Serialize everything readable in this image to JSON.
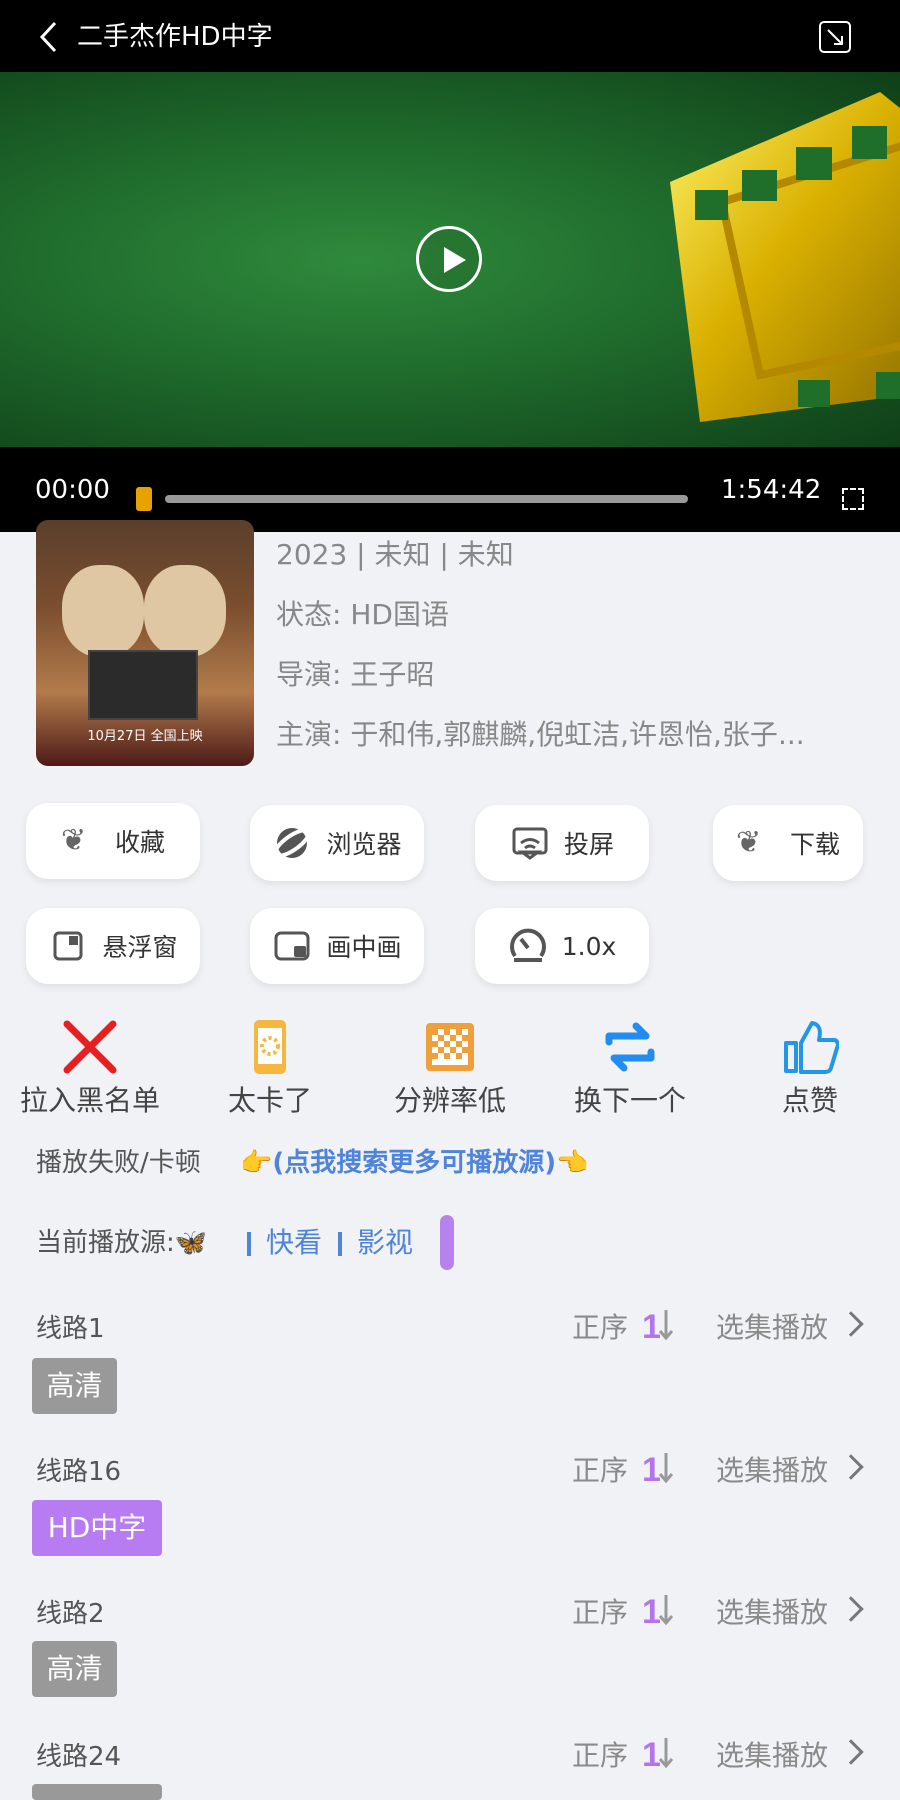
{
  "topbar": {
    "title": "二手杰作HD中字"
  },
  "player": {
    "current_time": "00:00",
    "total_time": "1:54:42"
  },
  "movie": {
    "poster_release": "10月27日 全国上映",
    "year_region_type": "2023 | 未知 | 未知",
    "status": "状态: HD国语",
    "director": "导演: 王子昭",
    "cast": "主演: 于和伟,郭麒麟,倪虹洁,许恩怡,张子..."
  },
  "buttons": [
    {
      "label": "收藏",
      "icon": "wing-icon"
    },
    {
      "label": "浏览器",
      "icon": "planet-icon"
    },
    {
      "label": "投屏",
      "icon": "screen-cast-icon"
    },
    {
      "label": "下载",
      "icon": "wing-icon"
    },
    {
      "label": "悬浮窗",
      "icon": "floating-window-icon"
    },
    {
      "label": "画中画",
      "icon": "picture-in-picture-icon"
    },
    {
      "label": "1.0x",
      "icon": "speed-gauge-icon"
    }
  ],
  "feedback": [
    {
      "label": "拉入黑名单",
      "icon": "red-x-icon"
    },
    {
      "label": "太卡了",
      "icon": "loading-phone-icon"
    },
    {
      "label": "分辨率低",
      "icon": "pixel-grid-icon"
    },
    {
      "label": "换下一个",
      "icon": "swap-arrows-icon"
    },
    {
      "label": "点赞",
      "icon": "thumbs-up-icon"
    }
  ],
  "playback": {
    "fail_text": "播放失败/卡顿",
    "search_text": "👉(点我搜索更多可播放源)👈",
    "source_label": "当前播放源:🦋",
    "source_primary": "快看",
    "source_secondary": "影视"
  },
  "routes": [
    {
      "name": "线路1",
      "sort": "正序",
      "select": "选集播放",
      "quality": "高清"
    },
    {
      "name": "线路16",
      "sort": "正序",
      "select": "选集播放",
      "quality": "HD中字"
    },
    {
      "name": "线路2",
      "sort": "正序",
      "select": "选集播放",
      "quality": "高清"
    },
    {
      "name": "线路24",
      "sort": "正序",
      "select": "选集播放"
    }
  ],
  "colors": {
    "accent": "#4f84d9",
    "purple": "#b882ee",
    "badge_gray": "#999999"
  }
}
